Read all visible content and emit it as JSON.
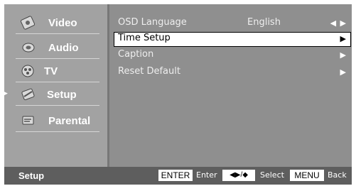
{
  "sidebar": {
    "items": [
      {
        "label": "Video",
        "icon": "video-icon"
      },
      {
        "label": "Audio",
        "icon": "audio-icon"
      },
      {
        "label": "TV",
        "icon": "tv-icon"
      },
      {
        "label": "Setup",
        "icon": "setup-icon",
        "active": true
      },
      {
        "label": "Parental",
        "icon": "parental-icon"
      }
    ]
  },
  "menu": {
    "rows": [
      {
        "label": "OSD Language",
        "value": "English",
        "arrow": "◀ ▶"
      },
      {
        "label": "Time Setup",
        "value": "",
        "arrow": "▶",
        "selected": true
      },
      {
        "label": "Caption",
        "value": "",
        "arrow": "▶"
      },
      {
        "label": "Reset Default",
        "value": "",
        "arrow": "▶"
      }
    ]
  },
  "status": {
    "title": "Setup",
    "enter_key": "ENTER",
    "enter_label": "Enter",
    "nav_key": "◀▶/◆",
    "select_label": "Select",
    "menu_key": "MENU",
    "back_label": "Back"
  },
  "colors": {
    "panel": "#8f8f8f",
    "sidebar": "#a2a2a2",
    "statusbar": "#5e5e5e",
    "highlight": "#ffffff"
  }
}
